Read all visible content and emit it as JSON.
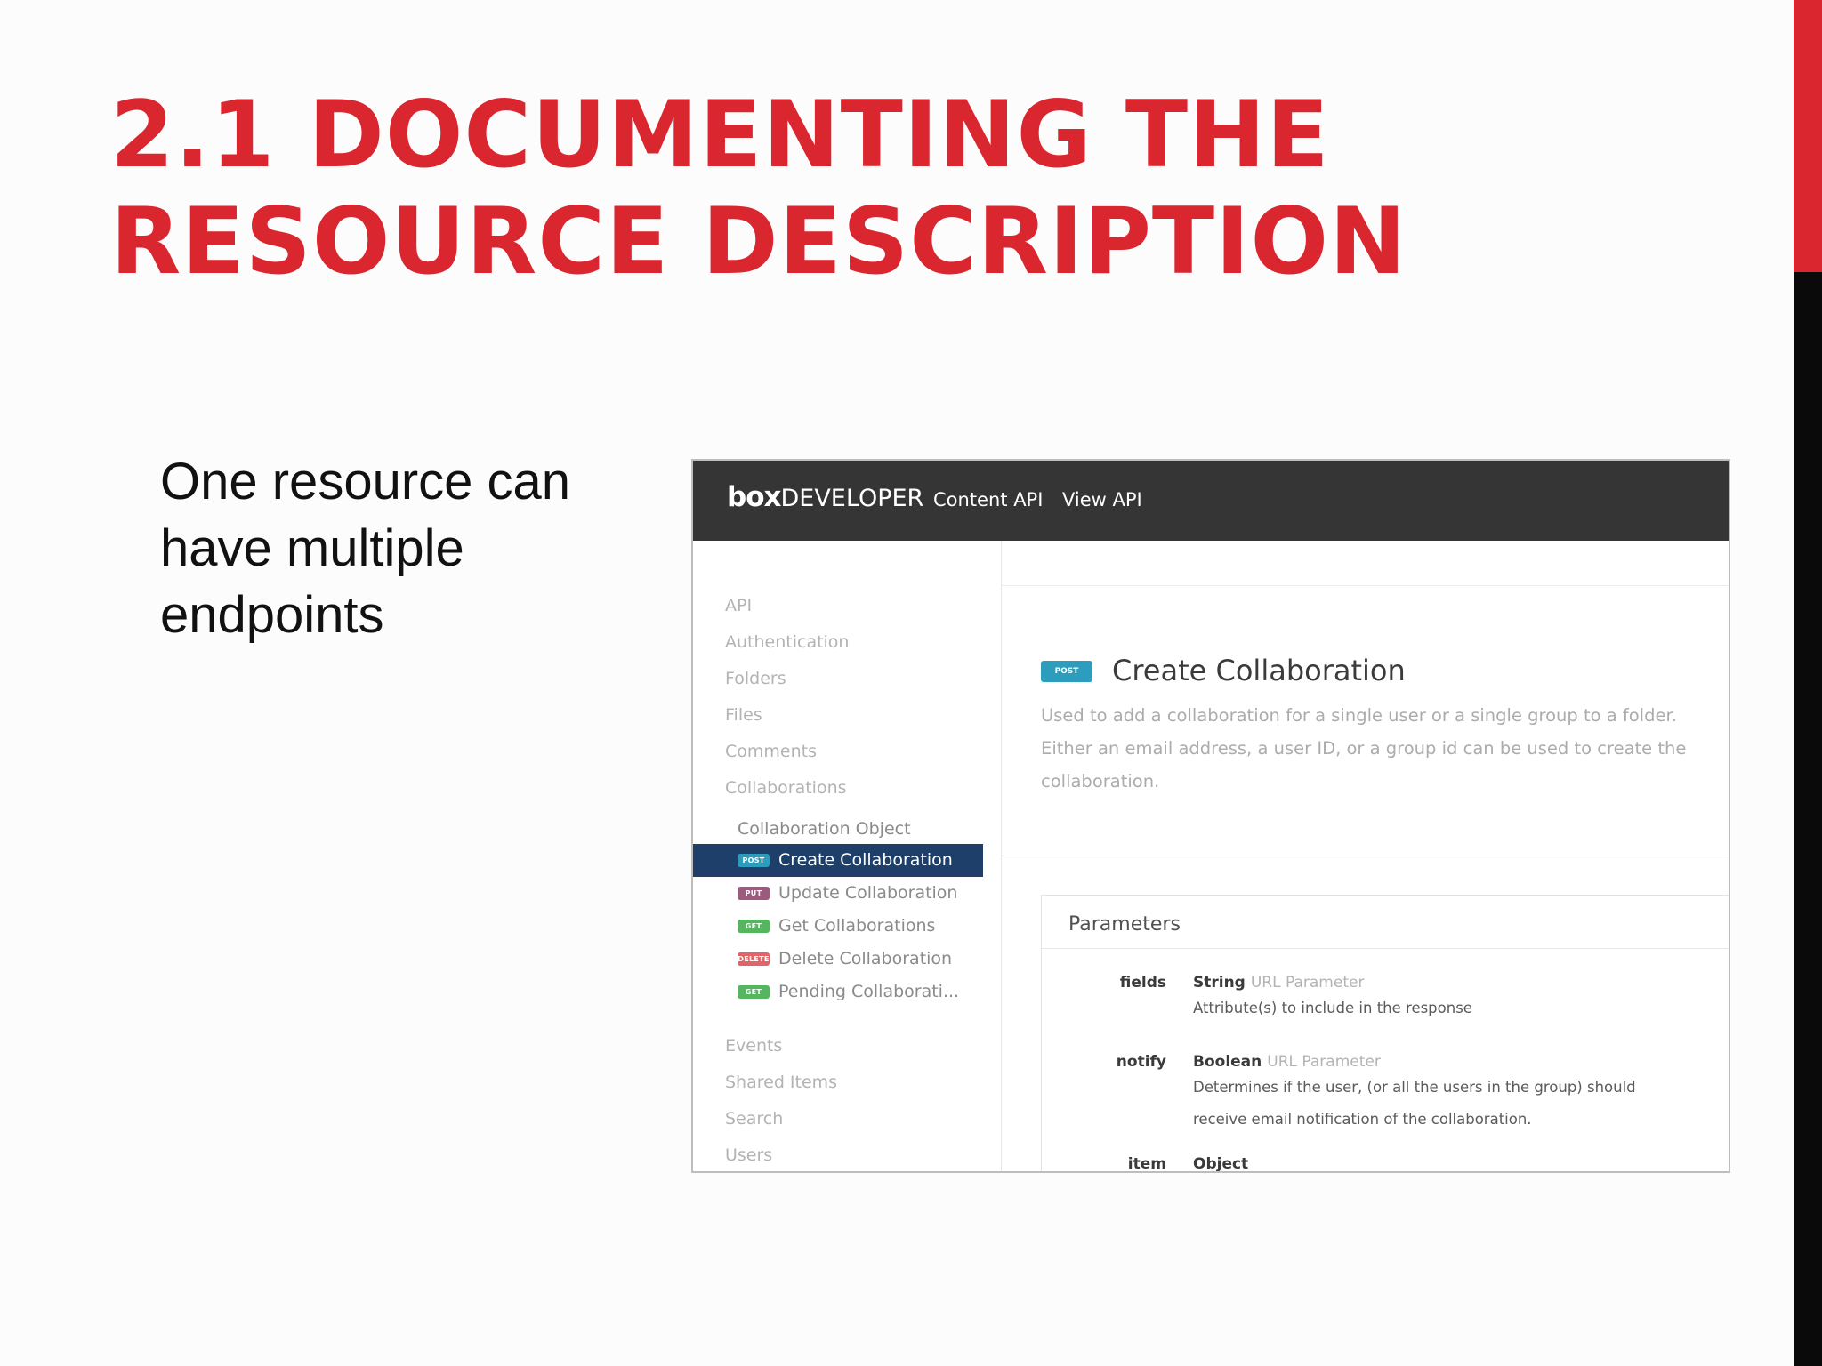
{
  "slide": {
    "title_line1": "2.1  DOCUMENTING THE",
    "title_line2": "RESOURCE DESCRIPTION",
    "bullet": "One resource can have multiple endpoints",
    "accent_colors": {
      "red": "#d9262f",
      "black": "#0a0a0a"
    }
  },
  "screenshot": {
    "brand_box": "box",
    "brand_developer": "DEVELOPER",
    "nav": [
      "Content API",
      "View API"
    ],
    "sidebar": {
      "categories_top": [
        "API",
        "Authentication",
        "Folders",
        "Files",
        "Comments",
        "Collaborations"
      ],
      "sub_header": "Collaboration Object",
      "endpoints": [
        {
          "method": "POST",
          "label": "Create Collaboration",
          "active": true,
          "color": "#2c9dbd"
        },
        {
          "method": "PUT",
          "label": "Update Collaboration",
          "active": false,
          "color": "#9b5a7e"
        },
        {
          "method": "GET",
          "label": "Get Collaborations",
          "active": false,
          "color": "#56b65f"
        },
        {
          "method": "DELETE",
          "label": "Delete Collaboration",
          "active": false,
          "color": "#e0646a"
        },
        {
          "method": "GET",
          "label": "Pending Collaborati...",
          "active": false,
          "color": "#56b65f"
        }
      ],
      "categories_bottom": [
        "Events",
        "Shared Items",
        "Search",
        "Users"
      ]
    },
    "endpoint": {
      "method": "POST",
      "title": "Create Collaboration",
      "description": "Used to add a collaboration for a single user or a single group to a folder. Either an email address, a user ID, or a group id can be used to create the collaboration."
    },
    "parameters": {
      "heading": "Parameters",
      "items": [
        {
          "name": "fields",
          "type": "String",
          "kind": "URL Parameter",
          "description": "Attribute(s) to include in the response"
        },
        {
          "name": "notify",
          "type": "Boolean",
          "kind": "URL Parameter",
          "description": "Determines if the user, (or all the users in the group) should receive email notification of the collaboration."
        },
        {
          "name": "item",
          "type": "Object",
          "kind": "",
          "description": ""
        }
      ]
    }
  }
}
